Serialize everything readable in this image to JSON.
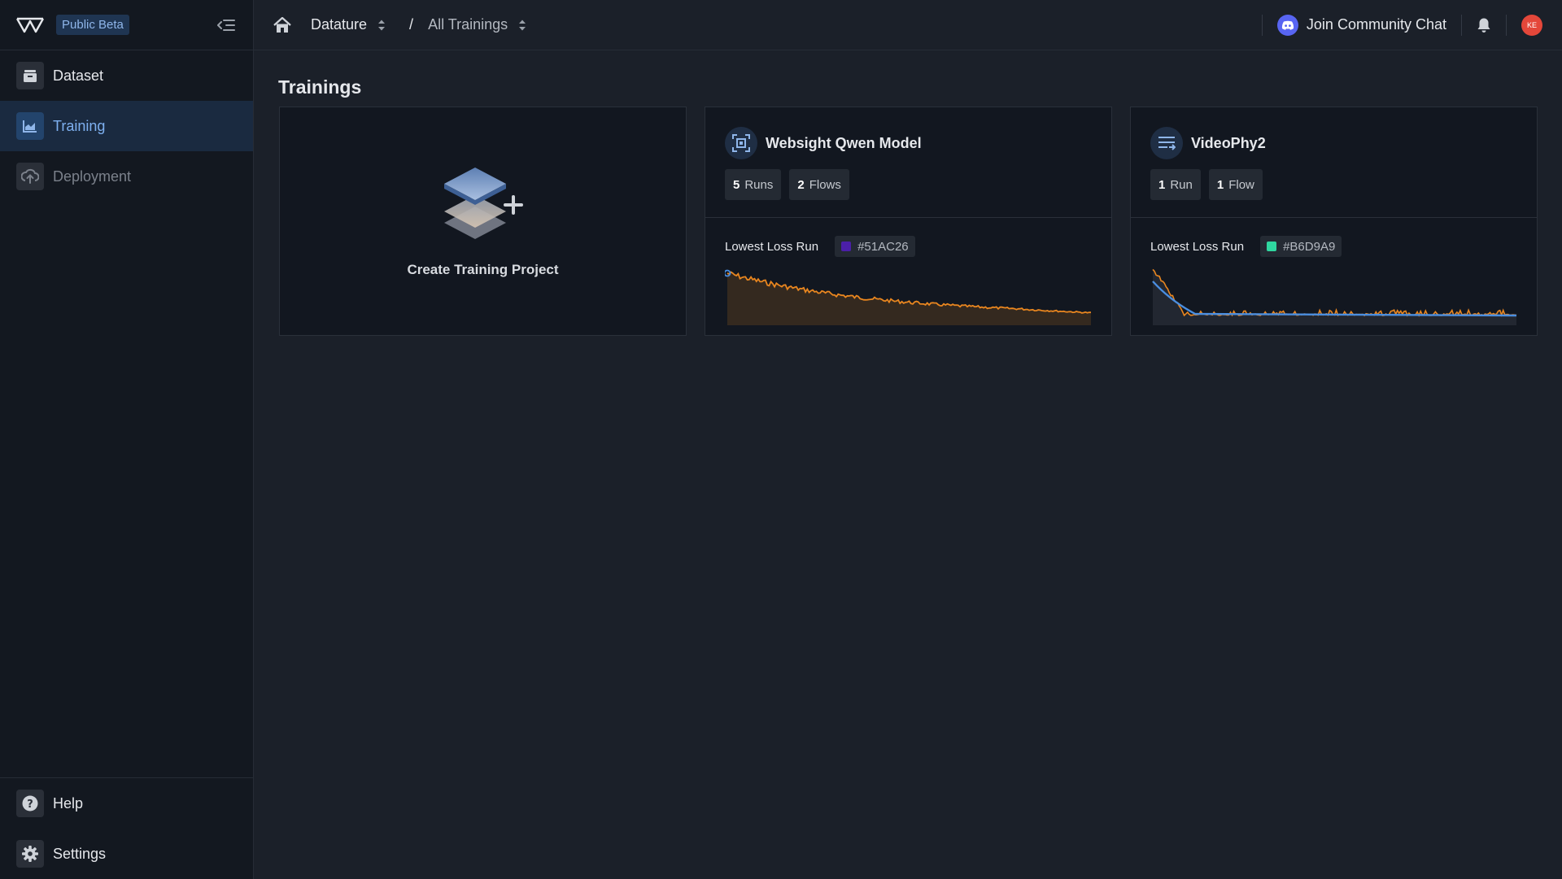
{
  "sidebar": {
    "beta_label": "Public Beta",
    "items": [
      {
        "label": "Dataset"
      },
      {
        "label": "Training"
      },
      {
        "label": "Deployment"
      }
    ],
    "bottom_items": [
      {
        "label": "Help"
      },
      {
        "label": "Settings"
      }
    ]
  },
  "topbar": {
    "workspace": "Datature",
    "separator": "/",
    "section": "All Trainings",
    "community_label": "Join Community Chat",
    "avatar_initials": "KE"
  },
  "main": {
    "title": "Trainings",
    "create_label": "Create Training Project",
    "projects": [
      {
        "title": "Websight Qwen Model",
        "runs_count": "5",
        "runs_label": "Runs",
        "flows_count": "2",
        "flows_label": "Flows",
        "lowest_loss_label": "Lowest Loss Run",
        "run_id": "#51AC26",
        "run_color": "#4b1fa8"
      },
      {
        "title": "VideoPhy2",
        "runs_count": "1",
        "runs_label": "Run",
        "flows_count": "1",
        "flows_label": "Flow",
        "lowest_loss_label": "Lowest Loss Run",
        "run_id": "#B6D9A9",
        "run_color": "#2fd7a0"
      }
    ]
  },
  "colors": {
    "accent": "#7eb0f0",
    "loss_line": "#e9861f",
    "smooth_line": "#4a8ee0"
  }
}
